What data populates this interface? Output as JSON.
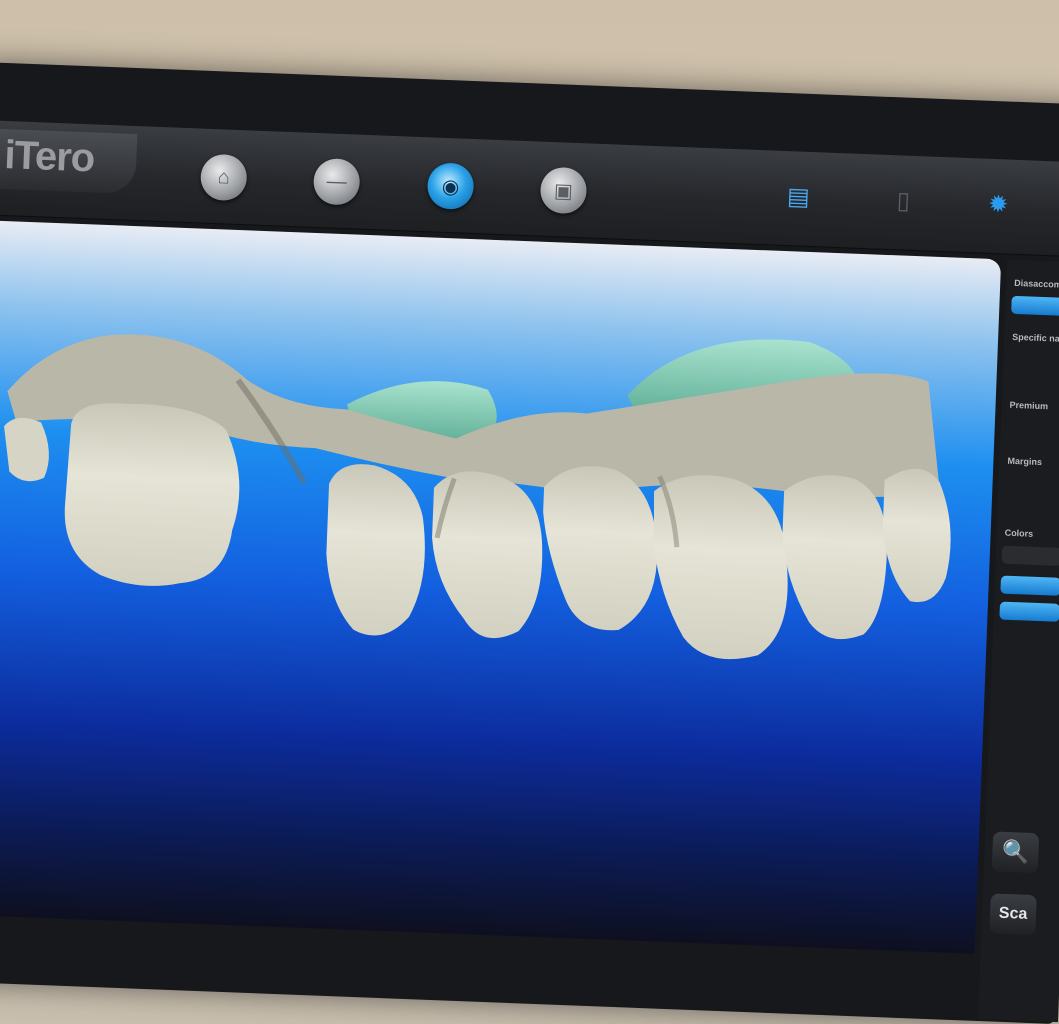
{
  "app": {
    "logo_text": "iTero"
  },
  "toolbar": {
    "modes": [
      {
        "icon": "camera-icon",
        "glyph": "⌂"
      },
      {
        "icon": "minus-icon",
        "glyph": "—"
      },
      {
        "icon": "eye-icon",
        "glyph": "◉"
      },
      {
        "icon": "layers-icon",
        "glyph": "▣"
      }
    ],
    "right_icons": [
      {
        "icon": "document-icon",
        "glyph": "▤",
        "color": "#4aa8f0"
      },
      {
        "icon": "trash-icon",
        "glyph": "▯",
        "color": "#5b5e62"
      },
      {
        "icon": "gear-icon",
        "glyph": "✹",
        "color": "#2a9cf0"
      }
    ]
  },
  "side_panel": {
    "labels": [
      "Diasaccom",
      "Specific na",
      "Premium",
      "Margins",
      "Colors"
    ],
    "search_glyph": "🔍",
    "scan_label": "Sca"
  },
  "viewport": {
    "zoom_icons": [
      "⊕",
      "⊖",
      "⊙",
      "▢",
      "✛",
      "◐"
    ]
  },
  "colors": {
    "accent": "#2aa2e8",
    "tooth": "#e2e0d2",
    "gum": "#7fd0ba"
  }
}
